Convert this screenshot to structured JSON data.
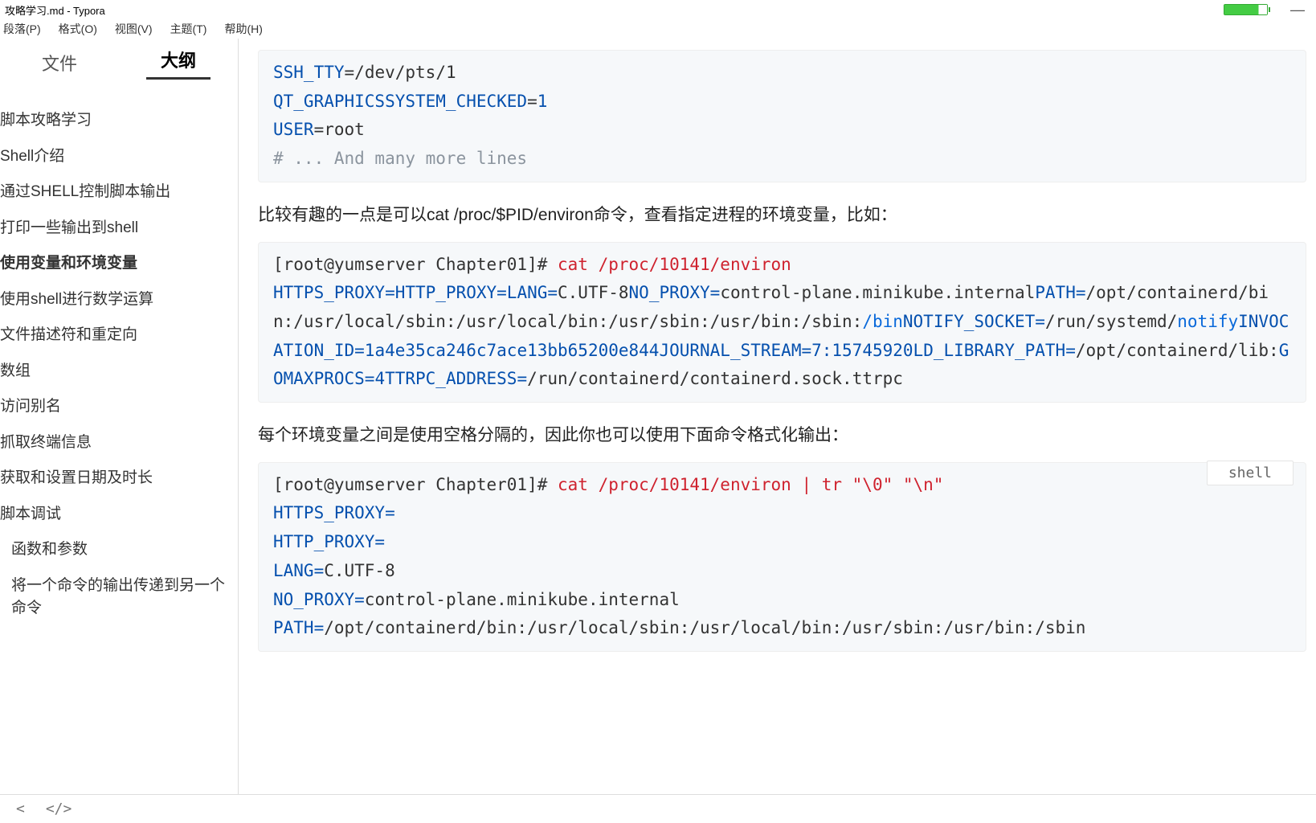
{
  "titlebar": {
    "filename": "攻略学习.md - Typora"
  },
  "menu": {
    "items": [
      "段落(P)",
      "格式(O)",
      "视图(V)",
      "主题(T)",
      "帮助(H)"
    ]
  },
  "sidebar": {
    "tabs": {
      "file": "文件",
      "outline": "大纲"
    },
    "outline": [
      {
        "label": "脚本攻略学习",
        "indent": 0,
        "active": false
      },
      {
        "label": "Shell介绍",
        "indent": 0,
        "active": false
      },
      {
        "label": "通过SHELL控制脚本输出",
        "indent": 0,
        "active": false
      },
      {
        "label": "打印一些输出到shell",
        "indent": 0,
        "active": false
      },
      {
        "label": "使用变量和环境变量",
        "indent": 0,
        "active": true
      },
      {
        "label": "使用shell进行数学运算",
        "indent": 0,
        "active": false
      },
      {
        "label": "文件描述符和重定向",
        "indent": 0,
        "active": false
      },
      {
        "label": "数组",
        "indent": 0,
        "active": false
      },
      {
        "label": "访问别名",
        "indent": 0,
        "active": false
      },
      {
        "label": "抓取终端信息",
        "indent": 0,
        "active": false
      },
      {
        "label": "获取和设置日期及时长",
        "indent": 0,
        "active": false
      },
      {
        "label": "脚本调试",
        "indent": 0,
        "active": false
      },
      {
        "label": "函数和参数",
        "indent": 1,
        "active": false
      },
      {
        "label": "将一个命令的输出传递到另一个命令",
        "indent": 1,
        "active": false
      }
    ]
  },
  "content": {
    "block1": {
      "l1_var": "SSH_TTY",
      "l1_val": "/dev/pts/1",
      "l2_var": "QT_GRAPHICSSYSTEM_CHECKED",
      "l2_val": "1",
      "l3_var": "USER",
      "l3_val": "root",
      "l4_comment": "# ... And many more lines"
    },
    "para1": "比较有趣的一点是可以cat /proc/$PID/environ命令，查看指定进程的环境变量，比如：",
    "block2": {
      "prompt": "[root@yumserver Chapter01]# ",
      "cmd": "cat /proc/10141/environ",
      "b_httpsproxy": "HTTPS_PROXY=",
      "b_httpproxy": "HTTP_PROXY=",
      "b_lang": "LANG=",
      "b_langval": "C.UTF-8",
      "b_noproxy": "NO_PROXY=",
      "b_noproxyval": "control-plane.minikube.internal",
      "b_path": "PATH=",
      "b_pathval": "/opt/containerd/bin:/usr/local/sbin:/usr/local/bin:/usr/sbin:/usr/bin:/sbin:",
      "b_bin": "/bin",
      "b_notify": "NOTIFY_SOCKET=",
      "b_notifyval": "/run/systemd/",
      "b_notify2": "notify",
      "b_invoc": "INVOCATION_ID=",
      "b_invocval": "1a4e35ca246c7ace13bb65200e844",
      "b_journal": "JOURNAL_STREAM=",
      "b_journalval": "7:15745920",
      "b_ldlib": "LD_LIBRARY_PATH=",
      "b_ldlibval": "/opt/containerd/lib:",
      "b_gomax": "GOMAXPROCS=",
      "b_gomaxval": "4",
      "b_ttrpc": "TTRPC_ADDRESS=",
      "b_ttrpcval": "/run/containerd/containerd.sock.ttrpc"
    },
    "para2": "每个环境变量之间是使用空格分隔的，因此你也可以使用下面命令格式化输出：",
    "langlabel": "shell",
    "block3": {
      "prompt": "[root@yumserver Chapter01]# ",
      "cmd": "cat /proc/10141/environ | tr \"\\0\" \"\\n\"",
      "l1": "HTTPS_PROXY=",
      "l2": "HTTP_PROXY=",
      "l3v": "LANG=",
      "l3val": "C.UTF-8",
      "l4v": "NO_PROXY=",
      "l4val": "control-plane.minikube.internal",
      "l5v": "PATH=",
      "l5val": "/opt/containerd/bin:/usr/local/sbin:/usr/local/bin:/usr/sbin:/usr/bin:/sbin"
    }
  },
  "footer": {
    "back": "<",
    "source": "</>"
  }
}
